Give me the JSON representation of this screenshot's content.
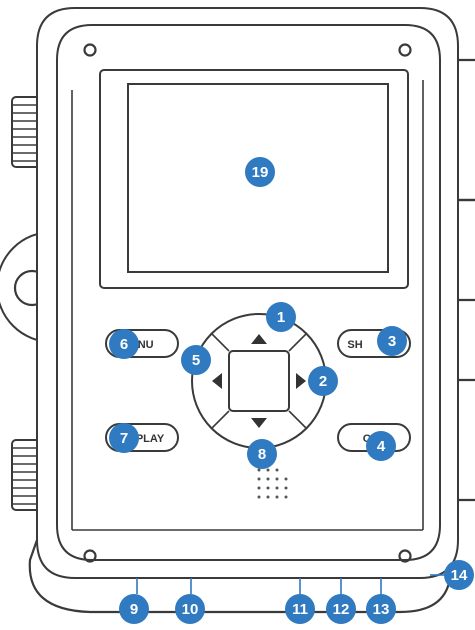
{
  "buttons": {
    "menu": "ENU",
    "play": "PLAY",
    "shot": "SH",
    "ok": "O"
  },
  "callouts": [
    "1",
    "2",
    "3",
    "4",
    "5",
    "6",
    "7",
    "8",
    "9",
    "10",
    "11",
    "12",
    "13",
    "14",
    "19"
  ],
  "colors": {
    "callout": "#2f7ac0",
    "outline": "#3a3a3a"
  }
}
